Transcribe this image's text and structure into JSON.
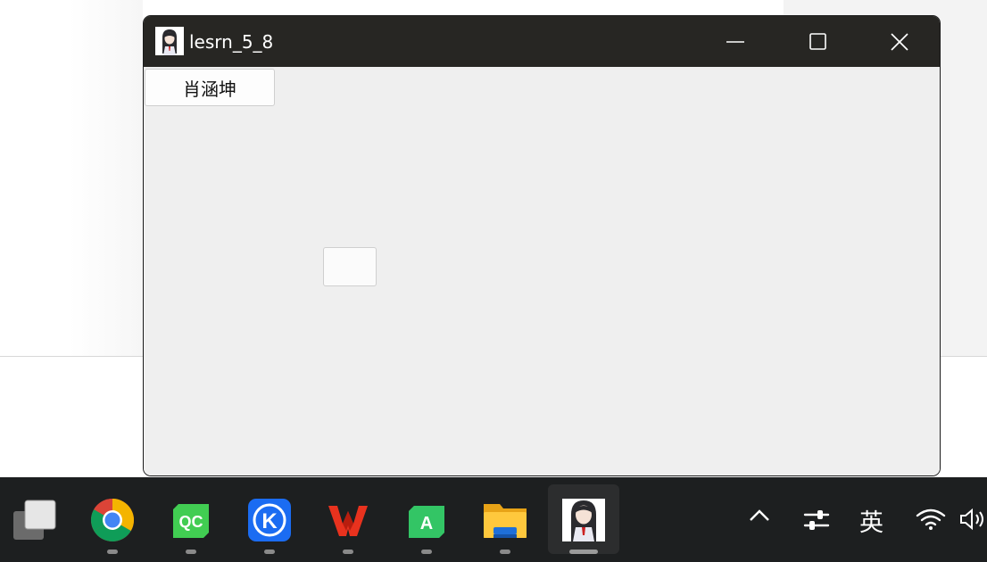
{
  "window": {
    "title": "lesrn_5_8",
    "buttons": {
      "minimize": "minimize",
      "maximize": "maximize",
      "close": "close"
    }
  },
  "client": {
    "push_button_label": "肖涵坤"
  },
  "taskbar": {
    "apps": [
      {
        "name": "task-view",
        "icon": "task-view-icon"
      },
      {
        "name": "chrome",
        "icon": "chrome-icon"
      },
      {
        "name": "qt-creator",
        "icon": "qt-creator-icon",
        "label": "QC"
      },
      {
        "name": "kugou",
        "icon": "kugou-icon",
        "label": "K"
      },
      {
        "name": "wps",
        "icon": "wps-icon",
        "label": "W"
      },
      {
        "name": "android-studio",
        "icon": "android-studio-icon",
        "label": "A"
      },
      {
        "name": "file-explorer",
        "icon": "folder-icon"
      },
      {
        "name": "lesrn-app",
        "icon": "anime-app-icon",
        "active": true
      }
    ],
    "tray": {
      "ime_label": "英"
    }
  }
}
